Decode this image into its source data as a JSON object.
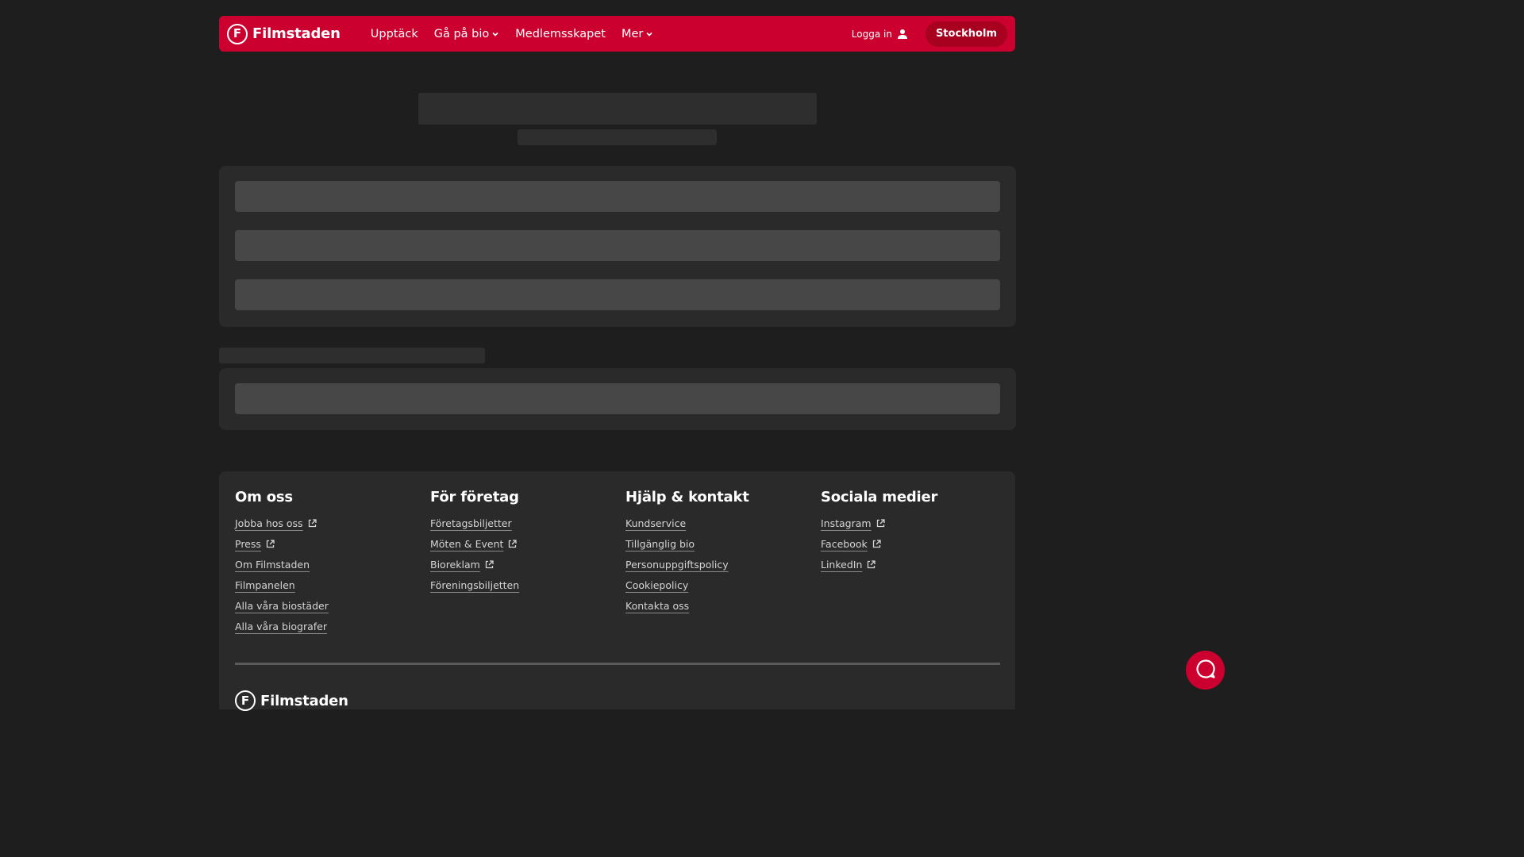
{
  "header": {
    "brand": "Filmstaden",
    "logo_letter": "F",
    "nav": [
      {
        "label": "Upptäck",
        "has_dropdown": false
      },
      {
        "label": "Gå på bio",
        "has_dropdown": true
      },
      {
        "label": "Medlemsskapet",
        "has_dropdown": false
      },
      {
        "label": "Mer",
        "has_dropdown": true
      }
    ],
    "login_label": "Logga in",
    "city_label": "Stockholm"
  },
  "footer": {
    "columns": [
      {
        "title": "Om oss",
        "links": [
          {
            "label": "Jobba hos oss",
            "external": true
          },
          {
            "label": "Press",
            "external": true
          },
          {
            "label": "Om Filmstaden",
            "external": false
          },
          {
            "label": "Filmpanelen",
            "external": false
          },
          {
            "label": "Alla våra biostäder",
            "external": false
          },
          {
            "label": "Alla våra biografer",
            "external": false
          }
        ]
      },
      {
        "title": "För företag",
        "links": [
          {
            "label": "Företagsbiljetter",
            "external": false
          },
          {
            "label": "Möten & Event",
            "external": true
          },
          {
            "label": "Bioreklam",
            "external": true
          },
          {
            "label": "Föreningsbiljetten",
            "external": false
          }
        ]
      },
      {
        "title": "Hjälp & kontakt",
        "links": [
          {
            "label": "Kundservice",
            "external": false
          },
          {
            "label": "Tillgänglig bio",
            "external": false
          },
          {
            "label": "Personuppgiftspolicy",
            "external": false
          },
          {
            "label": "Cookiepolicy",
            "external": false
          },
          {
            "label": "Kontakta oss",
            "external": false
          }
        ]
      },
      {
        "title": "Sociala medier",
        "links": [
          {
            "label": "Instagram",
            "external": true
          },
          {
            "label": "Facebook",
            "external": true
          },
          {
            "label": "LinkedIn",
            "external": true
          }
        ]
      }
    ]
  },
  "colors": {
    "brand_red": "#cc002e",
    "background": "#1e1e1e",
    "panel": "#2a2a2a",
    "skeleton": "#474747"
  },
  "icons": {
    "user": "user-icon",
    "external_link": "external-link-icon",
    "chevron": "chevron-down-icon",
    "chat": "chat-icon"
  }
}
